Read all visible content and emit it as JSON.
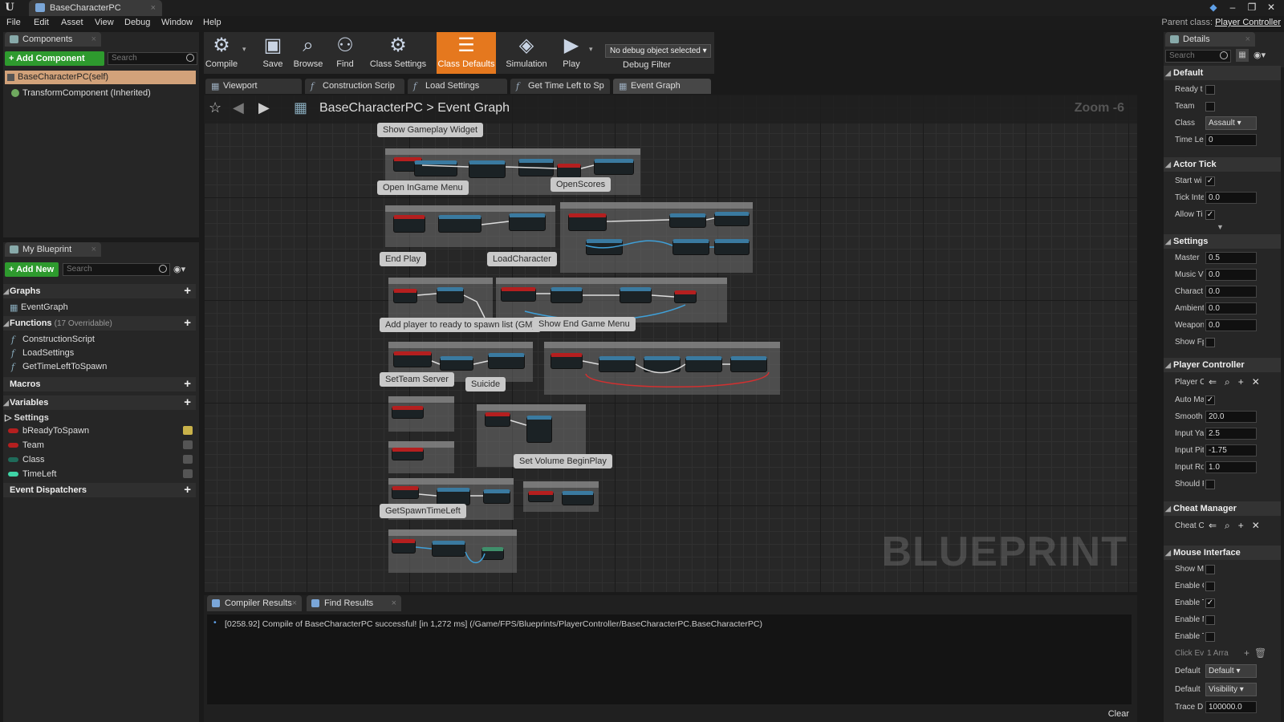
{
  "window": {
    "tab_title": "BaseCharacterPC"
  },
  "menu": [
    "File",
    "Edit",
    "Asset",
    "View",
    "Debug",
    "Window",
    "Help"
  ],
  "parent_class": {
    "label": "Parent class:",
    "value": "Player Controller"
  },
  "components": {
    "tab": "Components",
    "add_button": "+ Add Component",
    "search_placeholder": "Search",
    "items": [
      "BaseCharacterPC(self)",
      "TransformComponent (Inherited)"
    ]
  },
  "my_blueprint": {
    "tab": "My Blueprint",
    "add_button": "+ Add New",
    "search_placeholder": "Search",
    "graphs_header": "Graphs",
    "graphs": [
      "EventGraph"
    ],
    "functions_header": "Functions",
    "functions_count": "(17 Overridable)",
    "functions": [
      "ConstructionScript",
      "LoadSettings",
      "GetTimeLeftToSpawn"
    ],
    "macros_header": "Macros",
    "variables_header": "Variables",
    "variables_group": "Settings",
    "variables": [
      {
        "name": "bReadyToSpawn",
        "color": "#b41f1f"
      },
      {
        "name": "Team",
        "color": "#b41f1f"
      },
      {
        "name": "Class",
        "color": "#1f6b5a"
      },
      {
        "name": "TimeLeft",
        "color": "#3fd4a6"
      }
    ],
    "dispatchers_header": "Event Dispatchers"
  },
  "toolbar": {
    "buttons": [
      {
        "label": "Compile",
        "icon": "gear-check-icon"
      },
      {
        "label": "Save",
        "icon": "floppy-icon"
      },
      {
        "label": "Browse",
        "icon": "magnifier-icon"
      },
      {
        "label": "Find",
        "icon": "binoculars-icon"
      },
      {
        "label": "Class Settings",
        "icon": "gear-icon"
      },
      {
        "label": "Class Defaults",
        "icon": "defaults-icon"
      },
      {
        "label": "Simulation",
        "icon": "simulation-icon"
      },
      {
        "label": "Play",
        "icon": "play-icon"
      }
    ],
    "debug_selected": "No debug object selected",
    "debug_label": "Debug Filter"
  },
  "editor_tabs": [
    "Viewport",
    "Construction Scrip",
    "Load Settings",
    "Get Time Left to Sp",
    "Event Graph"
  ],
  "graph": {
    "breadcrumb_root": "BaseCharacterPC",
    "breadcrumb_sep": ">",
    "breadcrumb_leaf": "Event Graph",
    "zoom": "Zoom -6",
    "watermark": "BLUEPRINT",
    "comments": [
      "Show Gameplay Widget",
      "Open InGame Menu",
      "OpenScores",
      "End Play",
      "LoadCharacter",
      "Add player to ready to spawn list (GM)",
      "Show End Game Menu",
      "SetTeam Server",
      "Suicide",
      "Set Volume BeginPlay",
      "GetSpawnTimeLeft"
    ]
  },
  "bottom": {
    "tabs": [
      "Compiler Results",
      "Find Results"
    ],
    "log": "[0258.92] Compile of BaseCharacterPC successful! [in 1,272 ms] (/Game/FPS/Blueprints/PlayerController/BaseCharacterPC.BaseCharacterPC)",
    "clear": "Clear"
  },
  "details": {
    "tab": "Details",
    "search_placeholder": "Search",
    "cat_default": "Default",
    "ready_label": "Ready t",
    "team_label": "Team",
    "class_label": "Class",
    "class_value": "Assault",
    "timeleft_label": "Time Le",
    "timeleft_value": "0",
    "cat_actor_tick": "Actor Tick",
    "start_label": "Start wi",
    "tickint_label": "Tick Inte",
    "tickint_value": "0.0",
    "allow_label": "Allow Ti",
    "cat_settings": "Settings",
    "master_label": "Master",
    "master_value": "0.5",
    "music_label": "Music V",
    "music_value": "0.0",
    "charact_label": "Charact",
    "charact_value": "0.0",
    "ambient_label": "Ambient",
    "ambient_value": "0.0",
    "weapon_label": "Weapon",
    "weapon_value": "0.0",
    "showfps_label": "Show Fp",
    "cat_pc": "Player Controller",
    "playerc_label": "Player C",
    "automa_label": "Auto Ma",
    "smooth_label": "Smooth",
    "smooth_value": "20.0",
    "inputya_label": "Input Ya",
    "inputya_value": "2.5",
    "inputpi_label": "Input Pit",
    "inputpi_value": "-1.75",
    "inputro_label": "Input Ro",
    "inputro_value": "1.0",
    "should_label": "Should F",
    "cat_cheat": "Cheat Manager",
    "cheat_label": "Cheat C",
    "cat_mouse": "Mouse Interface",
    "showm_label": "Show M",
    "enable1_label": "Enable C",
    "enable2_label": "Enable T",
    "enable3_label": "Enable M",
    "enable4_label": "Enable T",
    "clickev_label": "Click Ev",
    "clickev_value": "1 Arra",
    "default1_label": "Default",
    "default1_value": "Default",
    "default2_label": "Default",
    "default2_value": "Visibility",
    "trace_label": "Trace D",
    "trace_value": "100000.0",
    "check": "✓"
  }
}
